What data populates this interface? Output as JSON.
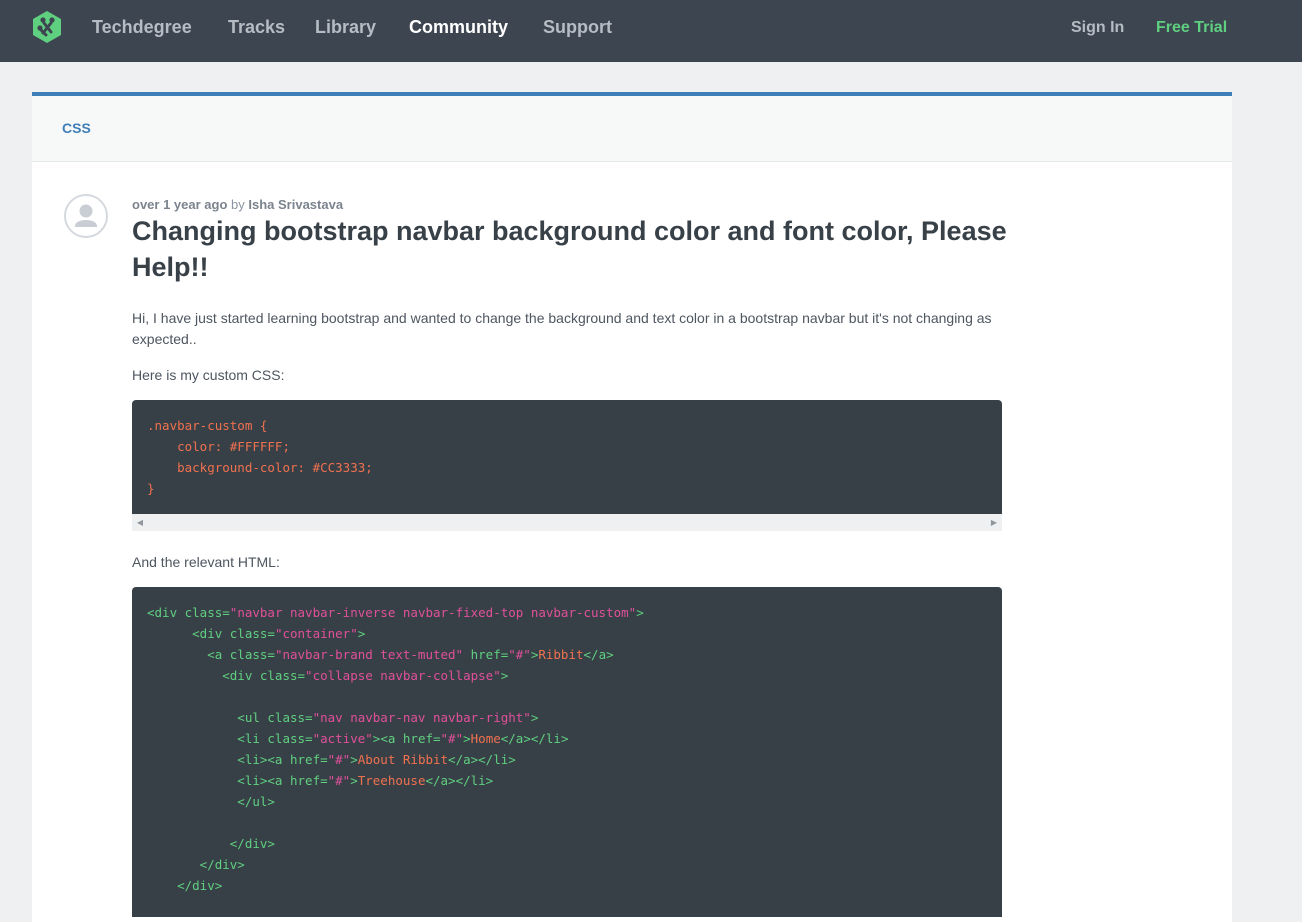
{
  "nav": {
    "links": [
      "Techdegree",
      "Tracks",
      "Library",
      "Community",
      "Support"
    ],
    "sign_in": "Sign In",
    "free_trial": "Free Trial",
    "active_link": "Community",
    "logo_icon": "treehouse-logo-icon"
  },
  "colors": {
    "nav_bg": "#3d4550",
    "accent_blue": "#3f7fb7",
    "trial_green": "#5fcf80",
    "code_bg": "#384047"
  },
  "post": {
    "category": "CSS",
    "time_ago": "over 1 year ago",
    "by": "by",
    "author": "Isha Srivastava",
    "title": "Changing bootstrap navbar background color and font color, Please Help!!",
    "intro": "Hi, I have just started learning bootstrap and wanted to change the background and text color in a bootstrap navbar but it's not changing as expected..",
    "css_label": "Here is my custom CSS:",
    "html_label": "And the relevant HTML:",
    "avatar_icon": "user-avatar-icon"
  },
  "code_css": [
    ".navbar-custom {",
    "    color: #FFFFFF;",
    "    background-color: #CC3333;",
    "}"
  ],
  "code_html": {
    "tag_open": "<div class=",
    "line1_val": "\"navbar navbar-inverse navbar-fixed-top navbar-custom\"",
    "gt": ">",
    "line2_open": "      <div class=",
    "line2_val": "\"container\"",
    "line3_open": "        <a class=",
    "line3_val": "\"navbar-brand text-muted\"",
    "href_attr": " href=",
    "hash_val": "\"#\"",
    "brand_text": "Ribbit",
    "a_close": "</a>",
    "line4_open": "          <div class=",
    "line4_val": "\"collapse navbar-collapse\"",
    "line6_open": "            <ul class=",
    "line6_val": "\"nav navbar-nav navbar-right\"",
    "line7_open": "            <li class=",
    "line7_val": "\"active\"",
    "line7_mid": "><a href=",
    "home_text": "Home",
    "li_close": "</a></li>",
    "line8_open": "            <li><a href=",
    "about_text": "About Ribbit",
    "treehouse_text": "Treehouse",
    "ul_close": "            </ul>",
    "div_close_1": "           </div>",
    "div_close_2": "       </div>",
    "div_close_3": "    </div>"
  }
}
